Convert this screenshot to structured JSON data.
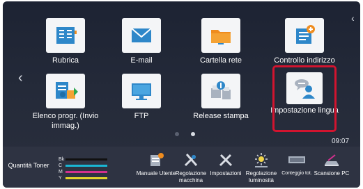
{
  "home": {
    "tiles": [
      {
        "label": "Rubrica",
        "icon": "address-book-icon"
      },
      {
        "label": "E-mail",
        "icon": "envelope-icon"
      },
      {
        "label": "Cartella rete",
        "icon": "folder-icon"
      },
      {
        "label": "Controllo indirizzo",
        "icon": "address-check-icon"
      },
      {
        "label": "Elenco progr. (Invio immag.)",
        "icon": "program-list-icon"
      },
      {
        "label": "FTP",
        "icon": "ftp-monitor-icon"
      },
      {
        "label": "Release stampa",
        "icon": "print-release-icon"
      },
      {
        "label": "Impostazione lingua",
        "icon": "language-icon"
      }
    ],
    "time": "09:07",
    "page_indicator": {
      "pages": 2,
      "current": 2
    }
  },
  "bottom_bar": {
    "toner": {
      "label": "Quantità Toner",
      "rows": [
        {
          "key": "Bk",
          "color": "#111111"
        },
        {
          "key": "C",
          "color": "#19b7d6"
        },
        {
          "key": "M",
          "color": "#d2308e"
        },
        {
          "key": "Y",
          "color": "#e3d52a"
        }
      ]
    },
    "shortcuts": [
      {
        "label": "Manuale Utente",
        "icon": "manual-icon"
      },
      {
        "label": "Regolazione macchina",
        "icon": "machine-adjust-icon"
      },
      {
        "label": "Impostazioni",
        "icon": "settings-tools-icon"
      },
      {
        "label": "Regolazione luminosità",
        "icon": "brightness-icon"
      },
      {
        "label": "Conteggio tot.",
        "icon": "counter-icon"
      },
      {
        "label": "Scansione PC",
        "icon": "pc-scan-icon"
      }
    ]
  },
  "colors": {
    "background": "#1d2333",
    "bottom_bar": "#2e3342",
    "selection": "#d2142f",
    "icon_blue": "#2e87c9",
    "icon_orange": "#ef8c1e"
  }
}
